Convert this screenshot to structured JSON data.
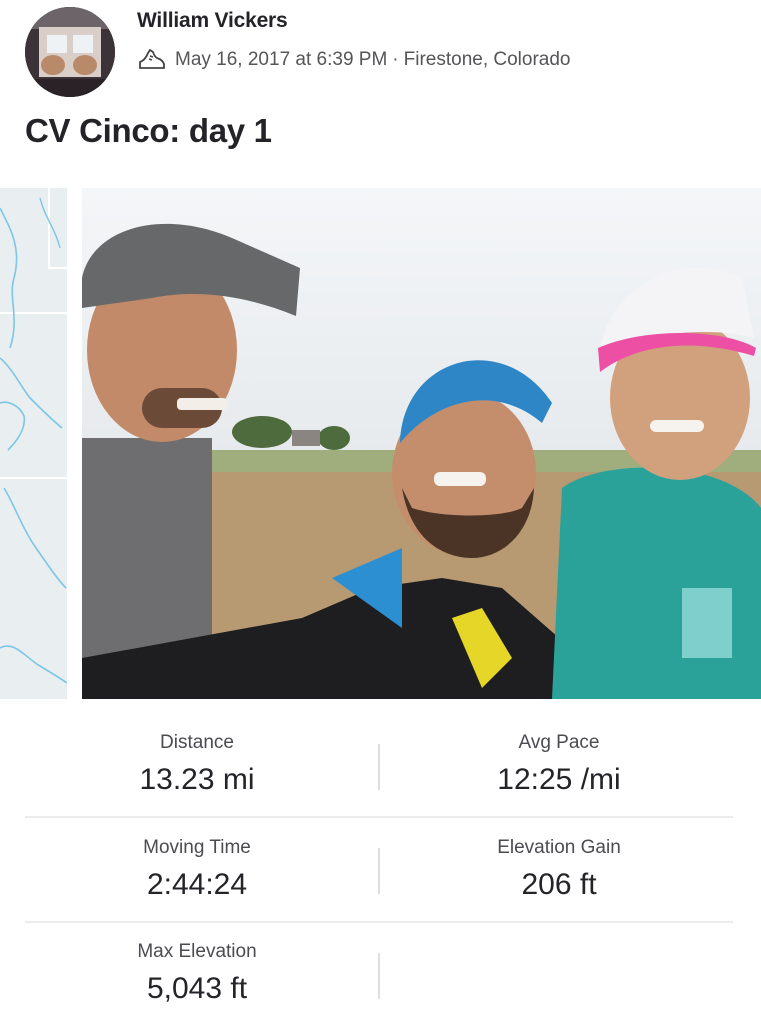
{
  "athlete": {
    "name": "William Vickers"
  },
  "activity": {
    "sport_icon": "shoe-icon",
    "date": "May 16, 2017 at 6:39 PM",
    "separator": "·",
    "location": "Firestone, Colorado",
    "title": "CV Cinco: day 1"
  },
  "stats": [
    {
      "label": "Distance",
      "value": "13.23 mi"
    },
    {
      "label": "Avg Pace",
      "value": "12:25 /mi"
    },
    {
      "label": "Moving Time",
      "value": "2:44:24"
    },
    {
      "label": "Elevation Gain",
      "value": "206 ft"
    },
    {
      "label": "Max Elevation",
      "value": "5,043 ft"
    }
  ],
  "colors": {
    "text": "#242428",
    "muted": "#555558",
    "map_bg": "#e9eef1",
    "map_line": "#7cc6e6",
    "divider": "#dedee0"
  }
}
